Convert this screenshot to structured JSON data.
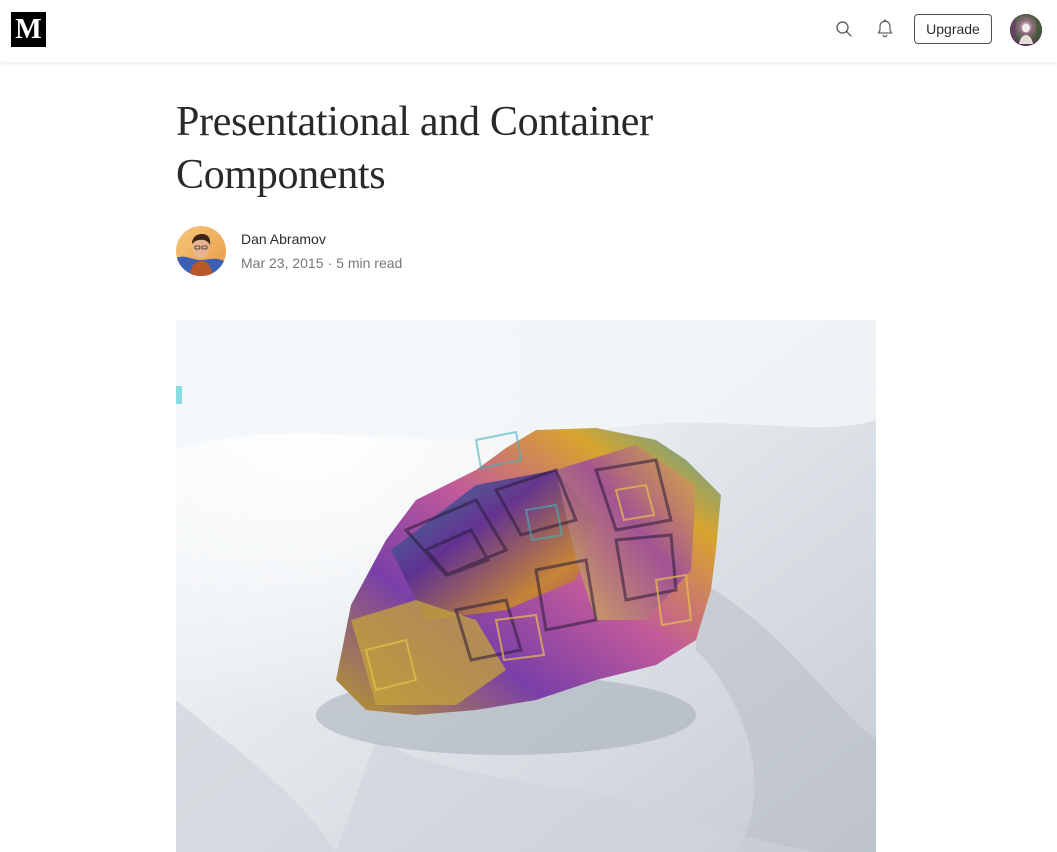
{
  "header": {
    "logo_letter": "M",
    "upgrade_label": "Upgrade",
    "icons": [
      "search-icon",
      "bell-icon"
    ]
  },
  "article": {
    "title": "Presentational and Container Components",
    "author": "Dan Abramov",
    "date": "Mar 23, 2015",
    "separator": "·",
    "read_time": "5 min read"
  },
  "hero_image": {
    "subject": "bismuth crystal on white fabric"
  },
  "colors": {
    "text_primary": "#292929",
    "text_secondary": "#757575",
    "logo_bg": "#000000"
  }
}
